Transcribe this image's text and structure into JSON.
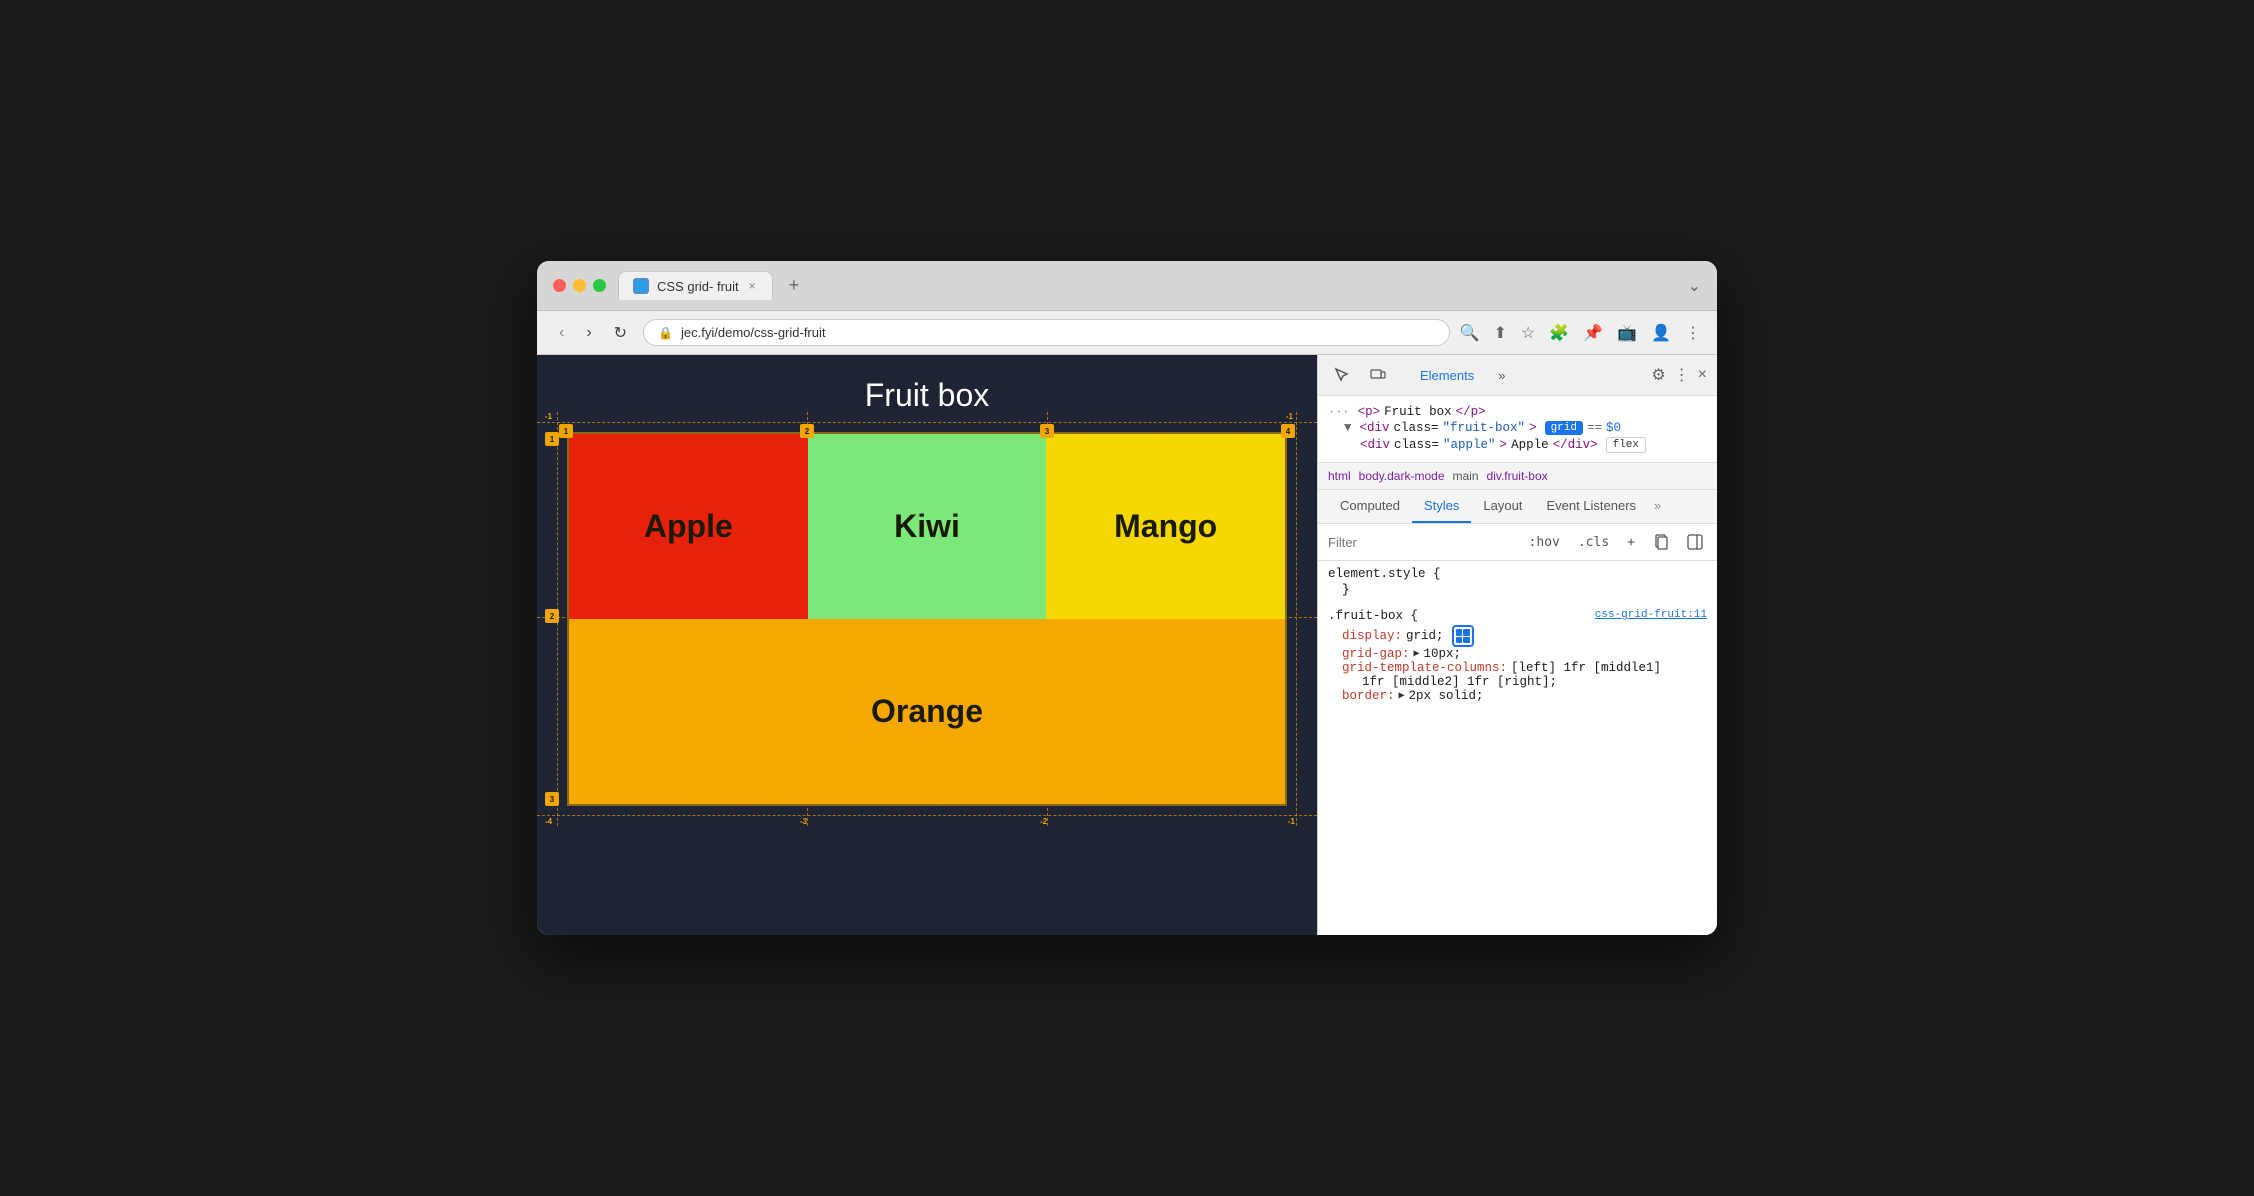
{
  "browser": {
    "tab_title": "CSS grid- fruit",
    "tab_close": "×",
    "tab_add": "+",
    "tab_menu": "⌄",
    "nav_back": "‹",
    "nav_forward": "›",
    "nav_refresh": "↻",
    "address": "jec.fyi/demo/css-grid-fruit",
    "lock_icon": "🔒"
  },
  "page": {
    "title": "Fruit box",
    "cells": {
      "apple": "Apple",
      "kiwi": "Kiwi",
      "mango": "Mango",
      "orange": "Orange"
    }
  },
  "devtools": {
    "toolbar_icons": [
      "cursor",
      "box",
      "more"
    ],
    "tabs": [
      "Elements",
      "»"
    ],
    "settings_icon": "⚙",
    "more_icon": "⋮",
    "close_icon": "×",
    "dom": {
      "line1": "<p>Fruit box</p>",
      "line2_pre": "<div class=\"fruit-box\">",
      "line2_badge": "grid",
      "line2_eq": "==",
      "line2_dollar": "$0",
      "line3_pre": "<div class=\"apple\">Apple</div>",
      "line3_badge": "flex"
    },
    "breadcrumb": [
      "html",
      "body.dark-mode",
      "main",
      "div.fruit-box"
    ],
    "styles_tabs": [
      "Computed",
      "Styles",
      "Layout",
      "Event Listeners",
      "»"
    ],
    "filter_placeholder": "Filter",
    "filter_hov": ":hov",
    "filter_cls": ".cls",
    "filter_add": "+",
    "css_rules": {
      "element_style": {
        "selector": "element.style {",
        "close": "}",
        "props": []
      },
      "fruit_box": {
        "selector": ".fruit-box {",
        "source": "css-grid-fruit:11",
        "close": "}",
        "props": [
          {
            "name": "display:",
            "value": "grid;"
          },
          {
            "name": "grid-gap:",
            "value": "▶ 10px;"
          },
          {
            "name": "grid-template-columns:",
            "value": "[left] 1fr [middle1]"
          },
          {
            "name": "",
            "value": "    1fr [middle2] 1fr [right];"
          },
          {
            "name": "border:",
            "value": "▶ 2px solid;"
          }
        ]
      }
    }
  }
}
